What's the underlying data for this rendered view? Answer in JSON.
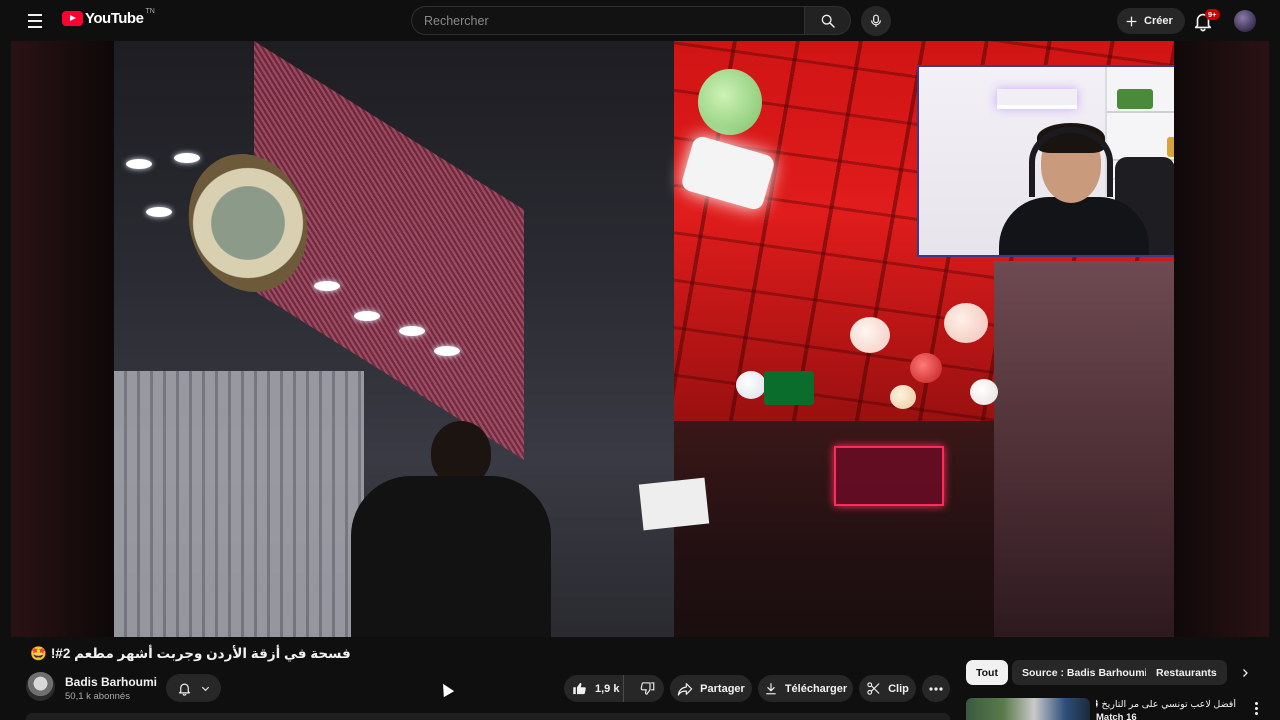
{
  "header": {
    "logo_text": "YouTube",
    "logo_country": "TN",
    "search_placeholder": "Rechercher",
    "create_label": "Créer",
    "notifications_badge": "9+"
  },
  "video": {
    "title": "فسحة في أزقة الأردن وجربت أشهر مطعم 2#!",
    "title_emoji": "🤩"
  },
  "channel": {
    "name": "Badis Barhoumi",
    "subscribers": "50,1 k abonnés"
  },
  "actions": {
    "like_count": "1,9 k",
    "share_label": "Partager",
    "download_label": "Télécharger",
    "clip_label": "Clip"
  },
  "chips": [
    {
      "label": "Tout",
      "active": true
    },
    {
      "label": "Source : Badis Barhoumi",
      "active": false
    },
    {
      "label": "Restaurants",
      "active": false
    }
  ],
  "recommendation": {
    "title": "أفضل لاعب تونسي على مر التاريخ ⚽",
    "subtitle": "Match 16"
  },
  "colors": {
    "background": "#0f0f0f",
    "brand_red": "#ff0033",
    "pill_bg": "#272727",
    "badge_red": "#cc0000"
  }
}
